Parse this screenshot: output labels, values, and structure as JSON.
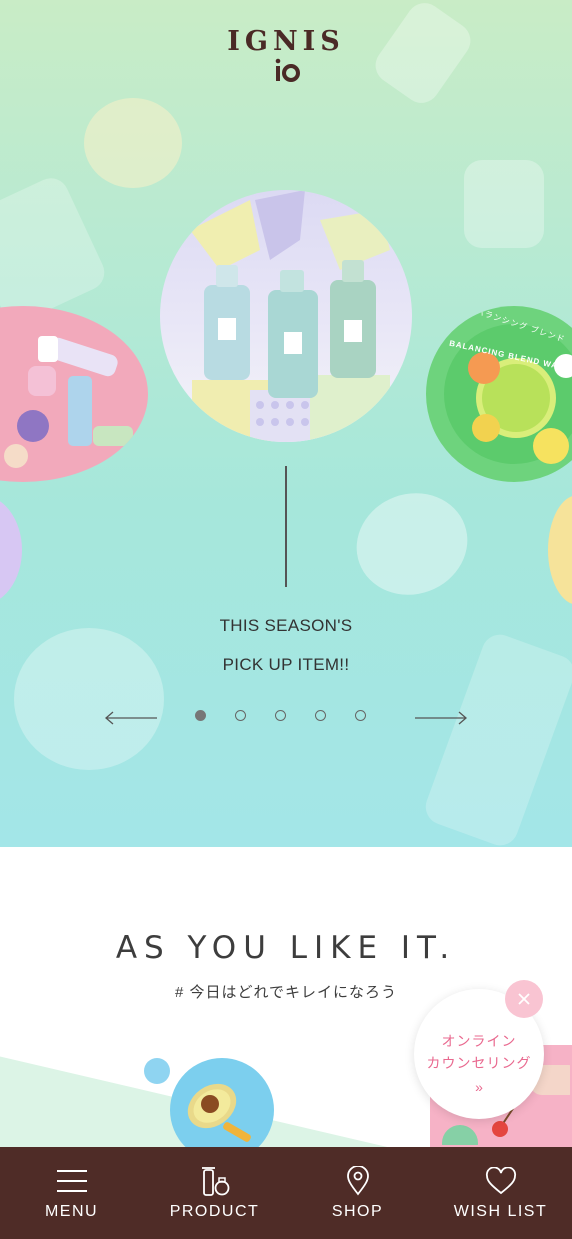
{
  "brand": {
    "logo_text": "IGNIS",
    "logo_mark": "io"
  },
  "hero": {
    "headline_line1": "THIS SEASON'S",
    "headline_line2": "PICK UP ITEM!!",
    "carousel": {
      "slide_count": 5,
      "active_index": 0
    },
    "slide_right_text": "BALANCING BLEND WATER",
    "slide_right_subtext": "バランシング ブレンド"
  },
  "section": {
    "title": "AS YOU LIKE IT.",
    "subtitle": "# 今日はどれでキレイになろう"
  },
  "counseling_popup": {
    "line1": "オンライン",
    "line2": "カウンセリング",
    "arrow": "»"
  },
  "bottom_nav": {
    "items": [
      {
        "label": "MENU",
        "icon": "menu-icon"
      },
      {
        "label": "PRODUCT",
        "icon": "product-icon"
      },
      {
        "label": "SHOP",
        "icon": "location-pin-icon"
      },
      {
        "label": "WISH LIST",
        "icon": "heart-icon"
      }
    ]
  },
  "colors": {
    "nav_background": "#4f2c27",
    "accent_pink": "#e9698f",
    "hero_gradient_top": "#c9ecc6",
    "hero_gradient_bottom": "#a3e6e8"
  }
}
